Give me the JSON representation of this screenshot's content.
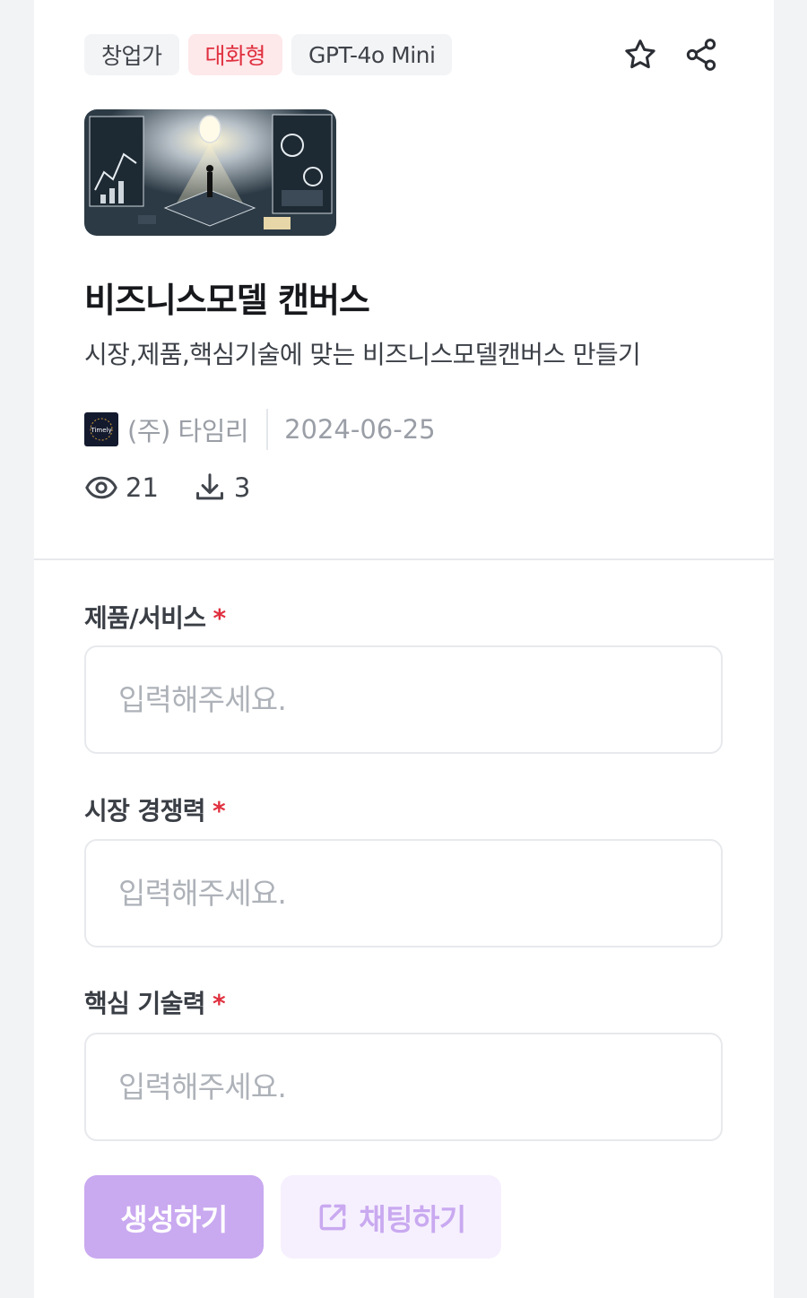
{
  "tags": [
    "창업가",
    "대화형",
    "GPT-4o Mini"
  ],
  "actions": {
    "favorite_icon": "star-icon",
    "share_icon": "share-icon"
  },
  "app": {
    "title": "비즈니스모델 캔버스",
    "description": "시장,제품,핵심기술에 맞는 비즈니스모델캔버스 만들기",
    "author": "(주) 타임리",
    "date": "2024-06-25",
    "views": "21",
    "downloads": "3",
    "thumbnail_icon": "business-illustration-image",
    "avatar_text": "Timely"
  },
  "form": {
    "fields": [
      {
        "label": "제품/서비스",
        "required_mark": "*",
        "placeholder": "입력해주세요."
      },
      {
        "label": "시장 경쟁력",
        "required_mark": "*",
        "placeholder": "입력해주세요."
      },
      {
        "label": "핵심 기술력",
        "required_mark": "*",
        "placeholder": "입력해주세요."
      }
    ],
    "generate_label": "생성하기",
    "chat_label": "채팅하기"
  },
  "colors": {
    "accent": "#c9a9f0",
    "accent_light": "#f6f0fe",
    "required": "#e0303f",
    "tag_red_bg": "#fde8ea"
  }
}
